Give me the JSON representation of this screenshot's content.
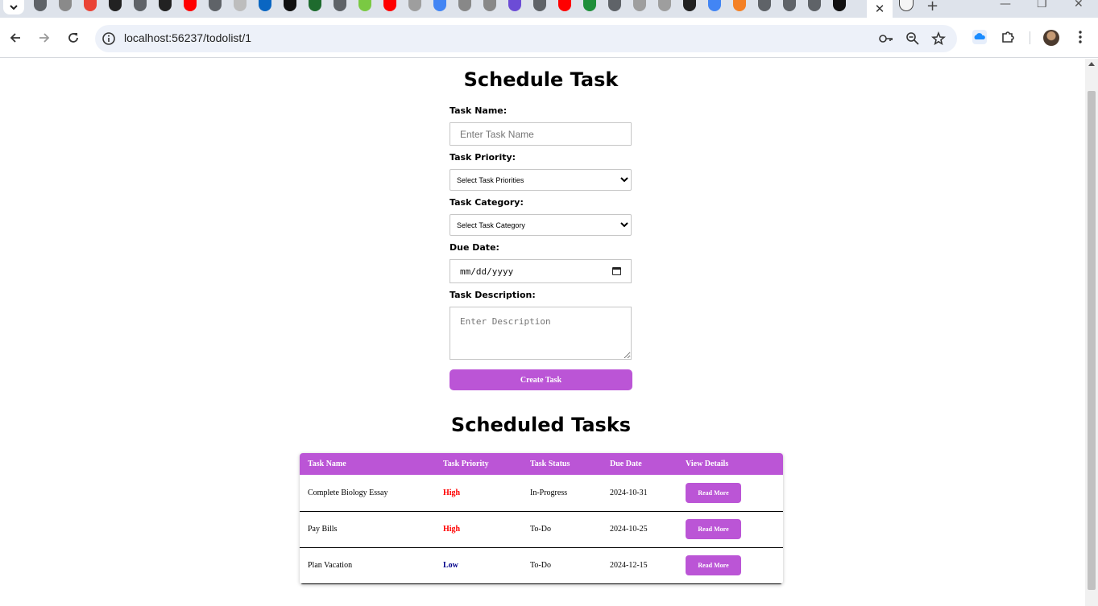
{
  "browser": {
    "url": "localhost:56237/todolist/1",
    "active_tab_close": "✕",
    "new_tab": "+",
    "minimize": "—",
    "restore": "❐",
    "close": "✕",
    "tab_favicons": [
      "globe-icon",
      "extension-icon",
      "gmail-icon",
      "upwork-icon",
      "globe-icon",
      "github-icon",
      "youtube-icon",
      "globe-icon",
      "angular-icon",
      "linkedin-icon",
      "medium-icon",
      "meetup-icon",
      "globe-icon",
      "cloud-icon",
      "youtube-icon",
      "drop-icon",
      "google-icon",
      "shoe-icon",
      "shoe-icon",
      "s-icon",
      "globe-icon",
      "youtube-icon",
      "w-icon",
      "globe-icon",
      "circle-icon",
      "circle-icon",
      "github-icon",
      "google-icon",
      "stack-icon",
      "globe-icon",
      "globe-icon",
      "globe-icon",
      "ninja-icon"
    ]
  },
  "form": {
    "title": "Schedule Task",
    "task_name_label": "Task Name:",
    "task_name_placeholder": "Enter Task Name",
    "priority_label": "Task Priority:",
    "priority_selected": "Select Task Priorities",
    "category_label": "Task Category:",
    "category_selected": "Select Task Category",
    "due_date_label": "Due Date:",
    "due_date_value": "mm/dd/yyyy",
    "description_label": "Task Description:",
    "description_placeholder": "Enter Description",
    "submit_label": "Create Task"
  },
  "tasks": {
    "title": "Scheduled Tasks",
    "headers": [
      "Task Name",
      "Task Priority",
      "Task Status",
      "Due Date",
      "View Details"
    ],
    "rows": [
      {
        "name": "Complete Biology Essay",
        "priority": "High",
        "status": "In-Progress",
        "due": "2024-10-31",
        "action": "Read More"
      },
      {
        "name": "Pay Bills",
        "priority": "High",
        "status": "To-Do",
        "due": "2024-10-25",
        "action": "Read More"
      },
      {
        "name": "Plan Vacation",
        "priority": "Low",
        "status": "To-Do",
        "due": "2024-12-15",
        "action": "Read More"
      }
    ]
  },
  "colors": {
    "accent": "#bb55d6",
    "priority_high": "#ff0000",
    "priority_low": "#00008b"
  }
}
